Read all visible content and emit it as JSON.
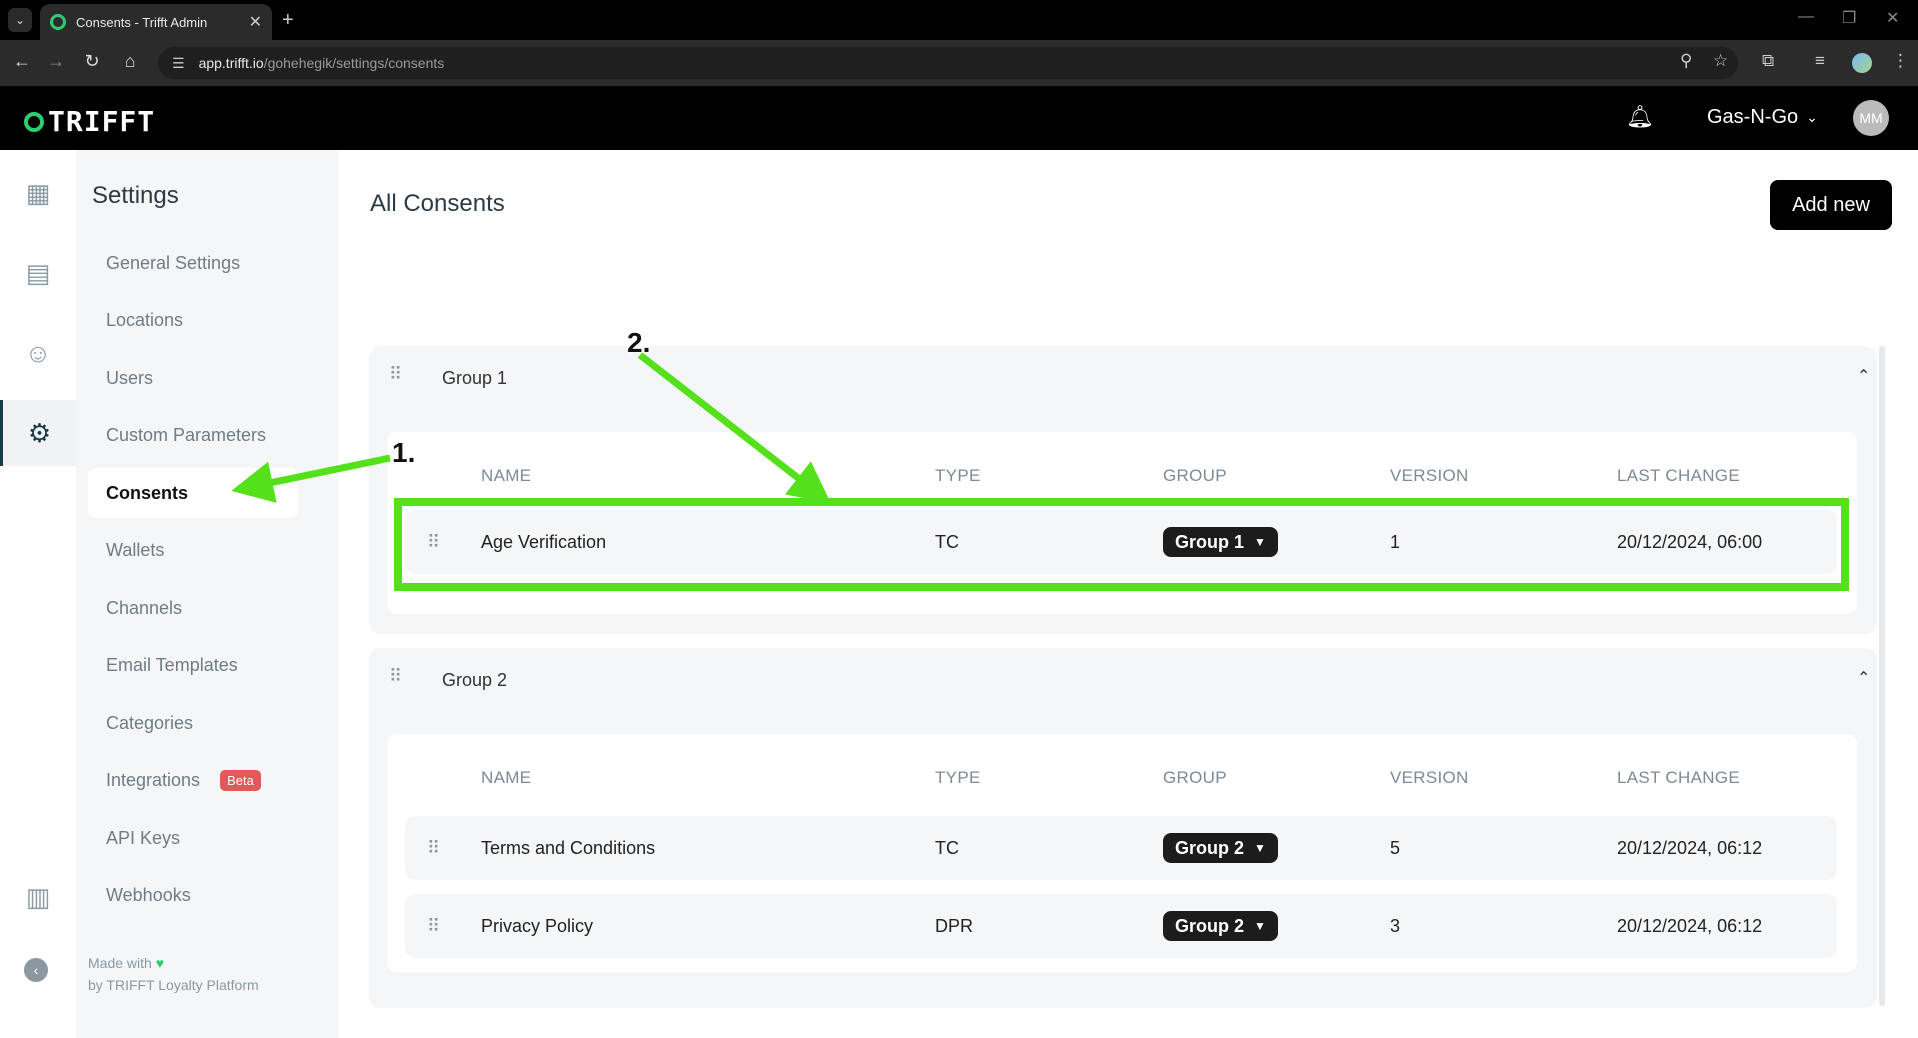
{
  "browser": {
    "tab_title": "Consents - Trifft Admin",
    "url_host": "app.trifft.io",
    "url_path": "/gohehegik/settings/consents"
  },
  "header": {
    "logo_text": "TRIFFT",
    "org_name": "Gas-N-Go",
    "avatar_initials": "MM",
    "brand_color": "#2ecc71"
  },
  "sidebar": {
    "title": "Settings",
    "items": [
      {
        "label": "General Settings"
      },
      {
        "label": "Locations"
      },
      {
        "label": "Users"
      },
      {
        "label": "Custom Parameters"
      },
      {
        "label": "Consents"
      },
      {
        "label": "Wallets"
      },
      {
        "label": "Channels"
      },
      {
        "label": "Email Templates"
      },
      {
        "label": "Categories"
      },
      {
        "label": "Integrations",
        "badge": "Beta"
      },
      {
        "label": "API Keys"
      },
      {
        "label": "Webhooks"
      }
    ],
    "active_item": "Consents",
    "footer_line1": "Made with",
    "footer_line2": "by TRIFFT Loyalty Platform"
  },
  "main": {
    "title": "All Consents",
    "add_button": "Add new",
    "columns": [
      "NAME",
      "TYPE",
      "GROUP",
      "VERSION",
      "LAST CHANGE"
    ],
    "groups": [
      {
        "name": "Group 1",
        "rows": [
          {
            "name": "Age Verification",
            "type": "TC",
            "group": "Group 1",
            "version": "1",
            "last_change": "20/12/2024, 06:00"
          }
        ]
      },
      {
        "name": "Group 2",
        "rows": [
          {
            "name": "Terms and Conditions",
            "type": "TC",
            "group": "Group 2",
            "version": "5",
            "last_change": "20/12/2024, 06:12"
          },
          {
            "name": "Privacy Policy",
            "type": "DPR",
            "group": "Group 2",
            "version": "3",
            "last_change": "20/12/2024, 06:12"
          }
        ]
      }
    ]
  },
  "annotations": {
    "step1": "1.",
    "step2": "2.",
    "highlight_color": "#54e01a"
  }
}
